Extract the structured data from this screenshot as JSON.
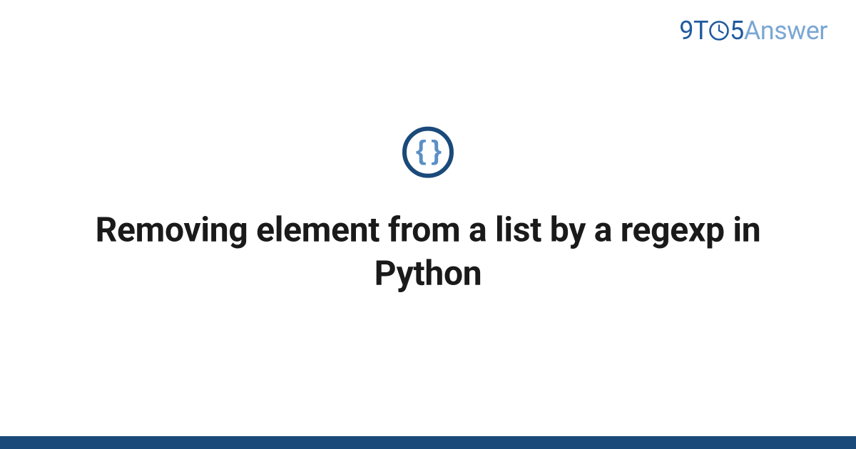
{
  "logo": {
    "part_9t": "9T",
    "part_5": "5",
    "part_answer": "Answer"
  },
  "icon": {
    "glyph": "{ }",
    "name": "code-braces-icon"
  },
  "title": "Removing element from a list by a regexp in Python",
  "colors": {
    "brand_dark": "#1a4a7a",
    "brand_mid": "#1f5a9e",
    "brand_light": "#7ba7d4",
    "brace_blue": "#5a8fc7"
  }
}
